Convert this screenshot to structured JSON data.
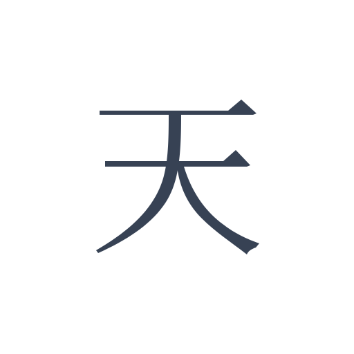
{
  "character": {
    "text": "天",
    "color": "#374254"
  },
  "background_color": "#ffffff"
}
